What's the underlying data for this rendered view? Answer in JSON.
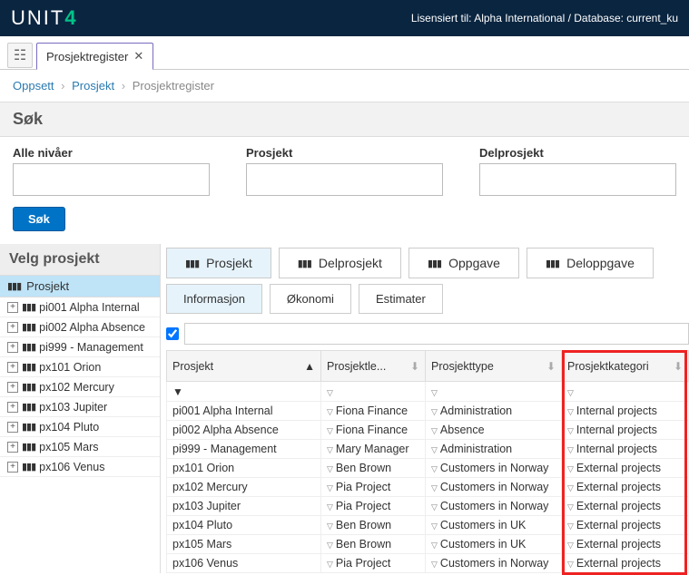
{
  "header": {
    "logo_prefix": "UNIT",
    "logo_suffix": "4",
    "license": "Lisensiert til: Alpha International / Database: current_ku"
  },
  "tab": {
    "title": "Prosjektregister"
  },
  "crumbs": {
    "a": "Oppsett",
    "b": "Prosjekt",
    "c": "Prosjektregister"
  },
  "search": {
    "title": "Søk",
    "fields": {
      "level": "Alle nivåer",
      "project": "Prosjekt",
      "sub": "Delprosjekt"
    },
    "button": "Søk"
  },
  "sidebar": {
    "title": "Velg prosjekt",
    "root": "Prosjekt",
    "items": [
      "pi001 Alpha Internal",
      "pi002 Alpha Absence",
      "pi999 - Management",
      "px101 Orion",
      "px102 Mercury",
      "px103 Jupiter",
      "px104 Pluto",
      "px105 Mars",
      "px106 Venus"
    ]
  },
  "views": {
    "project": "Prosjekt",
    "sub": "Delprosjekt",
    "task": "Oppgave",
    "subtask": "Deloppgave"
  },
  "subtabs": {
    "info": "Informasjon",
    "econ": "Økonomi",
    "est": "Estimater"
  },
  "table": {
    "headers": {
      "project": "Prosjekt",
      "leader": "Prosjektle...",
      "type": "Prosjekttype",
      "category": "Prosjektkategori"
    },
    "rows": [
      {
        "p": "pi001 Alpha Internal",
        "l": "Fiona Finance",
        "t": "Administration",
        "c": "Internal projects"
      },
      {
        "p": "pi002 Alpha Absence",
        "l": "Fiona Finance",
        "t": "Absence",
        "c": "Internal projects"
      },
      {
        "p": "pi999 - Management",
        "l": "Mary Manager",
        "t": "Administration",
        "c": "Internal projects"
      },
      {
        "p": "px101 Orion",
        "l": "Ben Brown",
        "t": "Customers in Norway",
        "c": "External projects"
      },
      {
        "p": "px102 Mercury",
        "l": "Pia Project",
        "t": "Customers in Norway",
        "c": "External projects"
      },
      {
        "p": "px103 Jupiter",
        "l": "Pia Project",
        "t": "Customers in Norway",
        "c": "External projects"
      },
      {
        "p": "px104 Pluto",
        "l": "Ben Brown",
        "t": "Customers in UK",
        "c": "External projects"
      },
      {
        "p": "px105 Mars",
        "l": "Ben Brown",
        "t": "Customers in UK",
        "c": "External projects"
      },
      {
        "p": "px106 Venus",
        "l": "Pia Project",
        "t": "Customers in Norway",
        "c": "External projects"
      }
    ]
  }
}
